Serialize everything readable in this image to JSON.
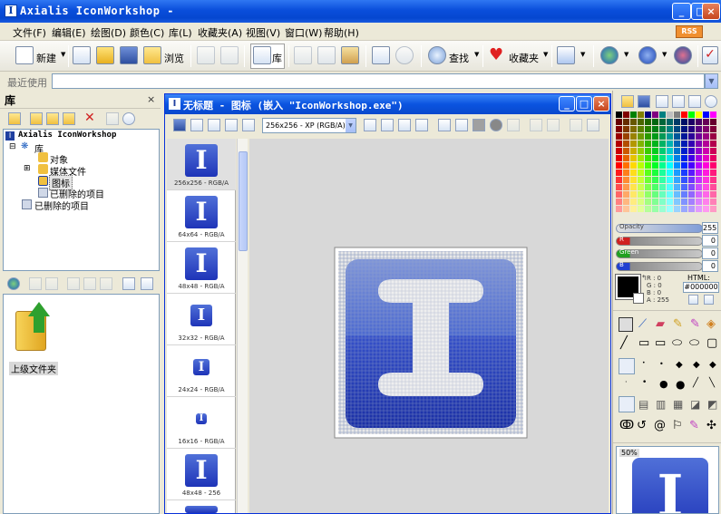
{
  "window": {
    "title": "Axialis IconWorkshop -"
  },
  "menu": [
    "文件(F)",
    "编辑(E)",
    "绘图(D)",
    "颜色(C)",
    "库(L)",
    "收藏夹(A)",
    "视图(V)",
    "窗口(W)",
    "帮助(H)"
  ],
  "rss": "RSS",
  "toolbar": {
    "new": "新建",
    "browse": "浏览",
    "library": "库",
    "find": "查找",
    "favorites": "收藏夹"
  },
  "recent": {
    "label": "最近使用"
  },
  "library": {
    "title": "库",
    "close": "×",
    "tree": {
      "root": "Axialis IconWorkshop",
      "lib": "库",
      "objects": "对象",
      "media": "媒体文件",
      "icons": "图标",
      "deleted_items": "已删除的项目",
      "deleted_root": "已删除的项目"
    }
  },
  "folder": {
    "label": "上级文件夹"
  },
  "doc": {
    "title": "无标题 - 图标 (嵌入 \"IconWorkshop.exe\")",
    "format_select": "256x256 - XP (RGB/A)",
    "icons": [
      {
        "label": "256x256 - RGB/A"
      },
      {
        "label": "64x64 - RGB/A"
      },
      {
        "label": "48x48 - RGB/A"
      },
      {
        "label": "32x32 - RGB/A"
      },
      {
        "label": "24x24 - RGB/A"
      },
      {
        "label": "16x16 - RGB/A"
      },
      {
        "label": "48x48 - 256"
      }
    ]
  },
  "color": {
    "opacity_label": "Opacity",
    "opacity": "255",
    "r": "0",
    "g": "0",
    "b": "0",
    "rgb": {
      "R": "R : 0",
      "G": "G : 0",
      "B": "B : 0",
      "A": "A : 255"
    },
    "html_label": "HTML:",
    "html": "#000000",
    "g_label": "Green",
    "b_label": "B",
    "r_label": "R"
  },
  "preview": {
    "zoom": "50%"
  },
  "colors": {
    "accent": "#0A4EDB",
    "icon_blue": "#1E34B8"
  }
}
